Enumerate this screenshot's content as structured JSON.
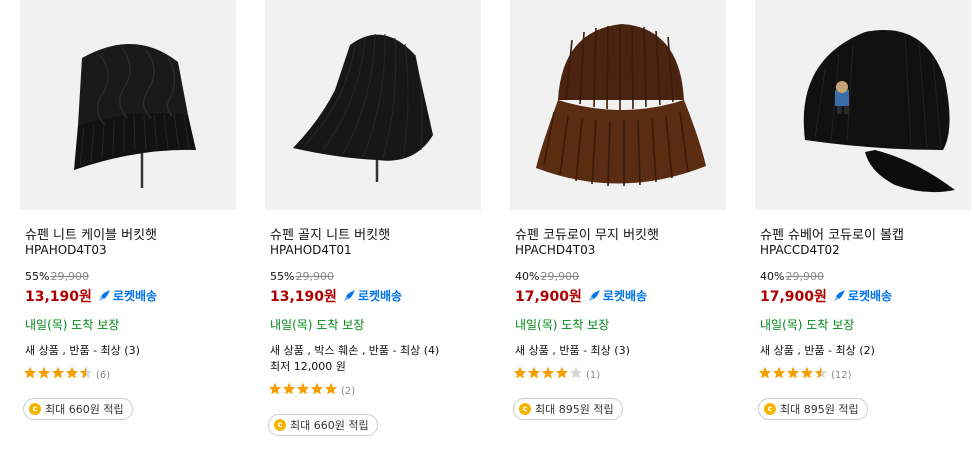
{
  "products": [
    {
      "name": "슈펜 니트 케이블 버킷햇",
      "code": "HPAHOD4T03",
      "discount": "55%",
      "original_price": "29,900",
      "price": "13,190",
      "price_unit": "원",
      "rocket_label": "로켓배송",
      "delivery": "내일(목) 도착 보장",
      "condition": "새 상품 , 반품 - 최상 (3)",
      "lowest": "",
      "rating": 4.5,
      "review_count": "(6)",
      "reward": "최대 660원 적립",
      "image_icon": "black-knit-cable-bucket-hat-image"
    },
    {
      "name": "슈펜 골지 니트 버킷햇",
      "code": "HPAHOD4T01",
      "discount": "55%",
      "original_price": "29,900",
      "price": "13,190",
      "price_unit": "원",
      "rocket_label": "로켓배송",
      "delivery": "내일(목) 도착 보장",
      "condition": "새 상품 , 박스 훼손 , 반품 - 최상 (4)",
      "lowest": "최저 12,000 원",
      "rating": 5,
      "review_count": "(2)",
      "reward": "최대 660원 적립",
      "image_icon": "black-ribbed-knit-bucket-hat-image"
    },
    {
      "name": "슈펜 코듀로이 무지 버킷햇",
      "code": "HPACHD4T03",
      "discount": "40%",
      "original_price": "29,900",
      "price": "17,900",
      "price_unit": "원",
      "rocket_label": "로켓배송",
      "delivery": "내일(목) 도착 보장",
      "condition": "새 상품 , 반품 - 최상 (3)",
      "lowest": "",
      "rating": 4,
      "review_count": "(1)",
      "reward": "최대 895원 적립",
      "image_icon": "brown-corduroy-bucket-hat-image"
    },
    {
      "name": "슈펜 슈베어 코듀로이 볼캡",
      "code": "HPACCD4T02",
      "discount": "40%",
      "original_price": "29,900",
      "price": "17,900",
      "price_unit": "원",
      "rocket_label": "로켓배송",
      "delivery": "내일(목) 도착 보장",
      "condition": "새 상품 , 반품 - 최상 (2)",
      "lowest": "",
      "rating": 4.5,
      "review_count": "(12)",
      "reward": "최대 895원 적립",
      "image_icon": "black-corduroy-ball-cap-image"
    }
  ],
  "colors": {
    "price": "#ae0000",
    "rocket": "#0073e9",
    "delivery": "#00891a",
    "star": "#f5a000",
    "coin": "#f5b400",
    "thumb_bg": "#f1f1f1"
  },
  "icons": {
    "rocket": "rocket-icon",
    "star": "star-icon",
    "coin": "coin-icon"
  }
}
